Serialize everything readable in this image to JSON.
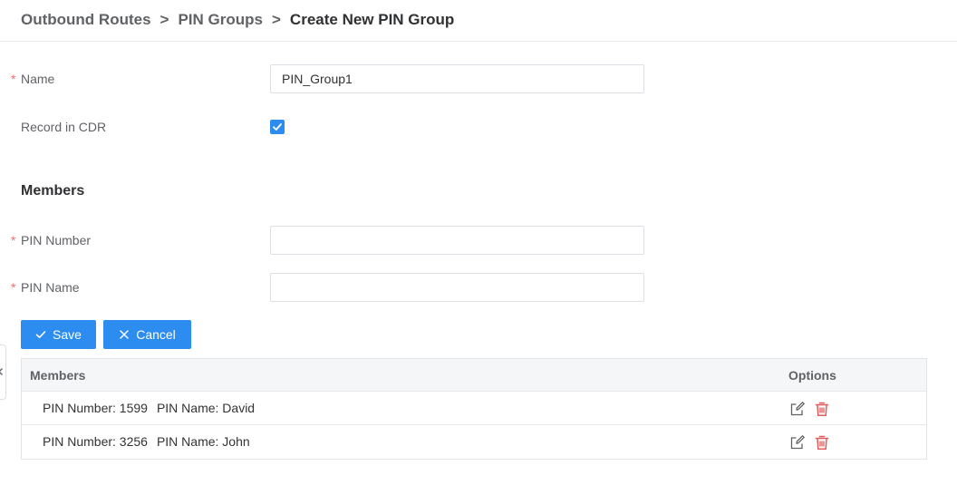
{
  "breadcrumb": {
    "items": [
      "Outbound Routes",
      "PIN Groups"
    ],
    "current": "Create New PIN Group",
    "separator": ">"
  },
  "form": {
    "required_mark": "*",
    "name_label": "Name",
    "name_value": "PIN_Group1",
    "record_cdr_label": "Record in CDR",
    "record_cdr_checked": true,
    "members_title": "Members",
    "pin_number_label": "PIN Number",
    "pin_number_value": "",
    "pin_name_label": "PIN Name",
    "pin_name_value": ""
  },
  "buttons": {
    "save_label": "Save",
    "cancel_label": "Cancel"
  },
  "table": {
    "headers": {
      "members": "Members",
      "options": "Options"
    },
    "rows": [
      {
        "pin_number_label": "PIN Number: 1599",
        "pin_name_label": "PIN Name: David"
      },
      {
        "pin_number_label": "PIN Number: 3256",
        "pin_name_label": "PIN Name: John"
      }
    ]
  },
  "icons": {
    "checkbox": "check-icon",
    "save": "check-icon",
    "cancel": "close-icon",
    "edit": "edit-icon",
    "delete": "trash-icon",
    "collapse": "chevron-left-icon"
  },
  "colors": {
    "primary": "#2d8cf0",
    "required": "#f56c6c",
    "delete": "#e35c5c",
    "edit": "#606266",
    "header_bg": "#f5f6f8"
  }
}
